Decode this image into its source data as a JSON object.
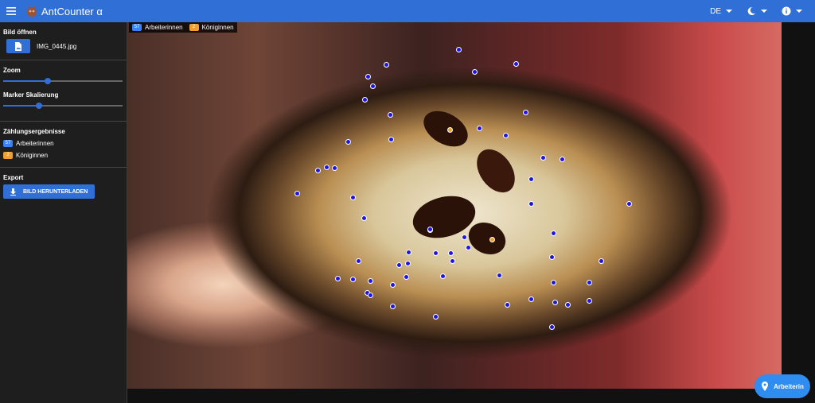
{
  "app": {
    "title": "AntCounter α"
  },
  "appbar": {
    "language": "DE"
  },
  "sidebar": {
    "open_title": "Bild öffnen",
    "file_name": "IMG_0445.jpg",
    "zoom_label": "Zoom",
    "zoom_value": 0.37,
    "marker_scale_label": "Marker Skalierung",
    "marker_scale_value": 0.3,
    "results_title": "Zählungsergebnisse",
    "workers_label": "Arbeiterinnen",
    "queens_label": "Königinnen",
    "export_title": "Export",
    "download_label": "BILD HERUNTERLADEN"
  },
  "counts": {
    "workers": "57",
    "queens": "2"
  },
  "overlay": {
    "workers_label": "Arbeiterinnen",
    "queens_label": "Königinnen"
  },
  "fab": {
    "label": "Arbeiterin"
  },
  "colors": {
    "primary": "#2f6fd6",
    "worker_badge": "#3b82f6",
    "queen_badge": "#f0a030",
    "worker_marker": "#1e14e6",
    "queen_marker": "#f0a030"
  },
  "icons": [
    "menu-icon",
    "ant-logo-icon",
    "caret-down-icon",
    "theme-icon",
    "info-icon",
    "image-file-icon",
    "download-icon",
    "add-marker-icon"
  ]
}
